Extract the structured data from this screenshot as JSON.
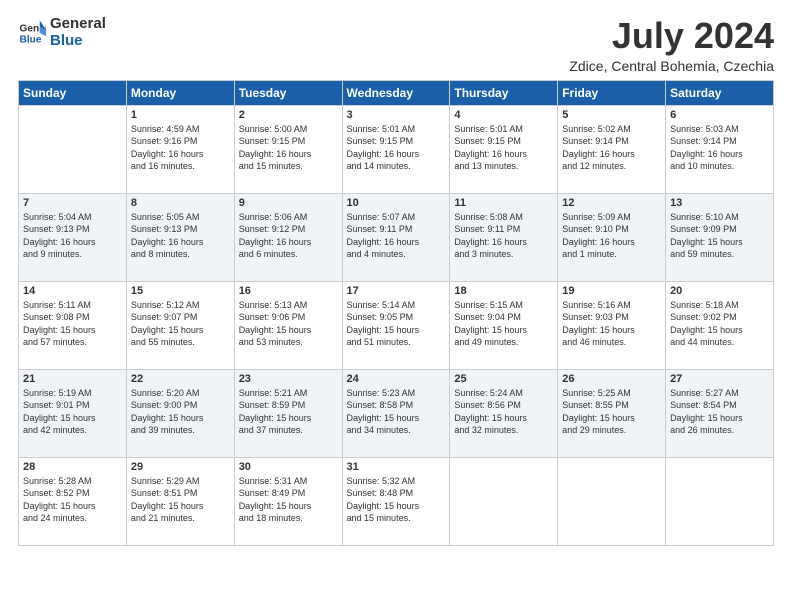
{
  "header": {
    "logo_general": "General",
    "logo_blue": "Blue",
    "month_title": "July 2024",
    "location": "Zdice, Central Bohemia, Czechia"
  },
  "calendar": {
    "days_of_week": [
      "Sunday",
      "Monday",
      "Tuesday",
      "Wednesday",
      "Thursday",
      "Friday",
      "Saturday"
    ],
    "weeks": [
      [
        {
          "day": "",
          "info": ""
        },
        {
          "day": "1",
          "info": "Sunrise: 4:59 AM\nSunset: 9:16 PM\nDaylight: 16 hours\nand 16 minutes."
        },
        {
          "day": "2",
          "info": "Sunrise: 5:00 AM\nSunset: 9:15 PM\nDaylight: 16 hours\nand 15 minutes."
        },
        {
          "day": "3",
          "info": "Sunrise: 5:01 AM\nSunset: 9:15 PM\nDaylight: 16 hours\nand 14 minutes."
        },
        {
          "day": "4",
          "info": "Sunrise: 5:01 AM\nSunset: 9:15 PM\nDaylight: 16 hours\nand 13 minutes."
        },
        {
          "day": "5",
          "info": "Sunrise: 5:02 AM\nSunset: 9:14 PM\nDaylight: 16 hours\nand 12 minutes."
        },
        {
          "day": "6",
          "info": "Sunrise: 5:03 AM\nSunset: 9:14 PM\nDaylight: 16 hours\nand 10 minutes."
        }
      ],
      [
        {
          "day": "7",
          "info": "Sunrise: 5:04 AM\nSunset: 9:13 PM\nDaylight: 16 hours\nand 9 minutes."
        },
        {
          "day": "8",
          "info": "Sunrise: 5:05 AM\nSunset: 9:13 PM\nDaylight: 16 hours\nand 8 minutes."
        },
        {
          "day": "9",
          "info": "Sunrise: 5:06 AM\nSunset: 9:12 PM\nDaylight: 16 hours\nand 6 minutes."
        },
        {
          "day": "10",
          "info": "Sunrise: 5:07 AM\nSunset: 9:11 PM\nDaylight: 16 hours\nand 4 minutes."
        },
        {
          "day": "11",
          "info": "Sunrise: 5:08 AM\nSunset: 9:11 PM\nDaylight: 16 hours\nand 3 minutes."
        },
        {
          "day": "12",
          "info": "Sunrise: 5:09 AM\nSunset: 9:10 PM\nDaylight: 16 hours\nand 1 minute."
        },
        {
          "day": "13",
          "info": "Sunrise: 5:10 AM\nSunset: 9:09 PM\nDaylight: 15 hours\nand 59 minutes."
        }
      ],
      [
        {
          "day": "14",
          "info": "Sunrise: 5:11 AM\nSunset: 9:08 PM\nDaylight: 15 hours\nand 57 minutes."
        },
        {
          "day": "15",
          "info": "Sunrise: 5:12 AM\nSunset: 9:07 PM\nDaylight: 15 hours\nand 55 minutes."
        },
        {
          "day": "16",
          "info": "Sunrise: 5:13 AM\nSunset: 9:06 PM\nDaylight: 15 hours\nand 53 minutes."
        },
        {
          "day": "17",
          "info": "Sunrise: 5:14 AM\nSunset: 9:05 PM\nDaylight: 15 hours\nand 51 minutes."
        },
        {
          "day": "18",
          "info": "Sunrise: 5:15 AM\nSunset: 9:04 PM\nDaylight: 15 hours\nand 49 minutes."
        },
        {
          "day": "19",
          "info": "Sunrise: 5:16 AM\nSunset: 9:03 PM\nDaylight: 15 hours\nand 46 minutes."
        },
        {
          "day": "20",
          "info": "Sunrise: 5:18 AM\nSunset: 9:02 PM\nDaylight: 15 hours\nand 44 minutes."
        }
      ],
      [
        {
          "day": "21",
          "info": "Sunrise: 5:19 AM\nSunset: 9:01 PM\nDaylight: 15 hours\nand 42 minutes."
        },
        {
          "day": "22",
          "info": "Sunrise: 5:20 AM\nSunset: 9:00 PM\nDaylight: 15 hours\nand 39 minutes."
        },
        {
          "day": "23",
          "info": "Sunrise: 5:21 AM\nSunset: 8:59 PM\nDaylight: 15 hours\nand 37 minutes."
        },
        {
          "day": "24",
          "info": "Sunrise: 5:23 AM\nSunset: 8:58 PM\nDaylight: 15 hours\nand 34 minutes."
        },
        {
          "day": "25",
          "info": "Sunrise: 5:24 AM\nSunset: 8:56 PM\nDaylight: 15 hours\nand 32 minutes."
        },
        {
          "day": "26",
          "info": "Sunrise: 5:25 AM\nSunset: 8:55 PM\nDaylight: 15 hours\nand 29 minutes."
        },
        {
          "day": "27",
          "info": "Sunrise: 5:27 AM\nSunset: 8:54 PM\nDaylight: 15 hours\nand 26 minutes."
        }
      ],
      [
        {
          "day": "28",
          "info": "Sunrise: 5:28 AM\nSunset: 8:52 PM\nDaylight: 15 hours\nand 24 minutes."
        },
        {
          "day": "29",
          "info": "Sunrise: 5:29 AM\nSunset: 8:51 PM\nDaylight: 15 hours\nand 21 minutes."
        },
        {
          "day": "30",
          "info": "Sunrise: 5:31 AM\nSunset: 8:49 PM\nDaylight: 15 hours\nand 18 minutes."
        },
        {
          "day": "31",
          "info": "Sunrise: 5:32 AM\nSunset: 8:48 PM\nDaylight: 15 hours\nand 15 minutes."
        },
        {
          "day": "",
          "info": ""
        },
        {
          "day": "",
          "info": ""
        },
        {
          "day": "",
          "info": ""
        }
      ]
    ]
  }
}
